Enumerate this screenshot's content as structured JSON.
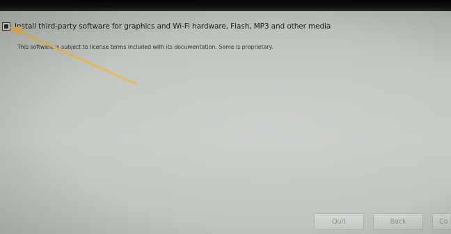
{
  "installer": {
    "third_party_option": {
      "label": "Install third-party software for graphics and Wi-Fi hardware, Flash, MP3 and other media",
      "description": "This software is subject to license terms included with its documentation. Some is proprietary.",
      "checked": true
    },
    "buttons": {
      "quit": "Quit",
      "back": "Back",
      "continue_partial": "Co"
    }
  },
  "annotation": {
    "arrow_color": "#e8b85a"
  }
}
